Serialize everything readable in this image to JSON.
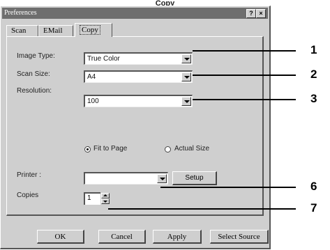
{
  "page": {
    "heading": "Copy"
  },
  "window": {
    "title": "Preferences",
    "help_label": "?",
    "close_label": "×"
  },
  "tabs": [
    {
      "label": "Scan",
      "active": false
    },
    {
      "label": "EMail",
      "active": false
    },
    {
      "label": "Copy",
      "active": true
    }
  ],
  "form": {
    "image_type": {
      "label": "Image Type:",
      "value": "True Color"
    },
    "scan_size": {
      "label": "Scan Size:",
      "value": "A4"
    },
    "resolution": {
      "label": "Resolution:",
      "value": "100"
    },
    "fit_option": {
      "fit_label": "Fit to Page",
      "actual_label": "Actual Size",
      "selected": "Fit to Page"
    },
    "printer": {
      "label": "Printer :",
      "value": "",
      "setup_label": "Setup"
    },
    "copies": {
      "label": "Copies",
      "value": "1"
    }
  },
  "buttons": {
    "ok": "OK",
    "cancel": "Cancel",
    "apply": "Apply",
    "select_source": "Select Source"
  },
  "callouts": [
    "1",
    "2",
    "3",
    "6",
    "7"
  ]
}
